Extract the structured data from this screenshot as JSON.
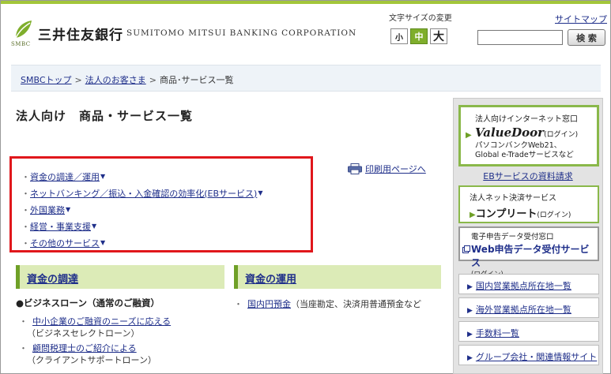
{
  "header": {
    "bank_name_jp": "三井住友銀行",
    "bank_name_en": "SUMITOMO MITSUI BANKING CORPORATION",
    "logo_small_text": "SMBC",
    "logo_icon": "smbc-leaf-logo",
    "font_size_label": "文字サイズの変更",
    "font_size_options": [
      "小",
      "中",
      "大"
    ],
    "font_size_selected": "中",
    "sitemap_label": "サイトマップ",
    "search_placeholder": "",
    "search_button_label": "検 索",
    "accent_color": "#a3c63a"
  },
  "breadcrumb": {
    "items": [
      "SMBCトップ",
      "法人のお客さま"
    ],
    "separator": ">",
    "current": "商品･サービス一覧"
  },
  "page": {
    "title": "法人向け　商品・サービス一覧",
    "print_label": "印刷用ページへ"
  },
  "anchor_links": {
    "bullet": "・",
    "items": [
      "資金の調達／運用",
      "ネットバンキング／振込・入金確認の効率化(EBサービス)",
      "外国業務",
      "経営・事業支援",
      "その他のサービス"
    ],
    "border_color": "#e0171c"
  },
  "categories": {
    "funding": {
      "label": "資金の調達",
      "section_title": "●ビジネスローン（通常のご融資）",
      "items": [
        {
          "label": "中小企業のご融資のニーズに応える",
          "note": "（ビジネスセレクトローン）"
        },
        {
          "label": "顧問税理士のご紹介による",
          "note": "（クライアントサポートローン）"
        }
      ]
    },
    "investment": {
      "label": "資金の運用",
      "items": [
        {
          "label": "国内円預金",
          "note": "（当座勘定、決済用普通預金など"
        }
      ]
    }
  },
  "sidebar": {
    "valuedoor": {
      "line1": "法人向けインターネット窓口",
      "name": "ValueDoor",
      "login": "(ログイン)",
      "line3a": "パソコンバンクWeb21、",
      "line3b": "Global e-Tradeサービスなど"
    },
    "eb_materials": "EBサービスの資料請求",
    "complete": {
      "line1": "法人ネット決済サービス",
      "name": "コンプリート",
      "login": "(ログイン)"
    },
    "web_tax": {
      "line1": "電子申告データ受付窓口",
      "name": "Web申告データ受付サービス",
      "login": "(ログイン)"
    },
    "links": [
      "国内営業拠点所在地一覧",
      "海外営業拠点所在地一覧",
      "手数料一覧",
      "グループ会社・関連情報サイト"
    ]
  }
}
